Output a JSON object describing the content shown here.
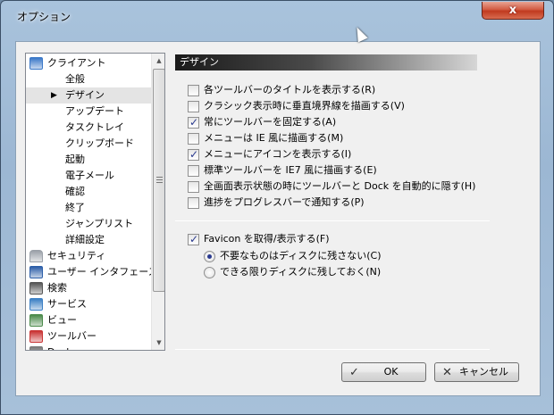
{
  "window": {
    "title": "オプション",
    "close_glyph": "x"
  },
  "tree": {
    "items": [
      {
        "label": "クライアント",
        "icon": "client-icon",
        "level": 0
      },
      {
        "label": "全般",
        "level": 1
      },
      {
        "label": "デザイン",
        "level": 1,
        "selected": true,
        "arrow": "▶"
      },
      {
        "label": "アップデート",
        "level": 1
      },
      {
        "label": "タスクトレイ",
        "level": 1
      },
      {
        "label": "クリップボード",
        "level": 1
      },
      {
        "label": "起動",
        "level": 1
      },
      {
        "label": "電子メール",
        "level": 1
      },
      {
        "label": "確認",
        "level": 1
      },
      {
        "label": "終了",
        "level": 1
      },
      {
        "label": "ジャンプリスト",
        "level": 1
      },
      {
        "label": "詳細設定",
        "level": 1
      },
      {
        "label": "セキュリティ",
        "icon": "lock-icon",
        "level": 0
      },
      {
        "label": "ユーザー インタフェース",
        "icon": "user-interface-icon",
        "level": 0
      },
      {
        "label": "検索",
        "icon": "search-icon",
        "level": 0
      },
      {
        "label": "サービス",
        "icon": "services-icon",
        "level": 0
      },
      {
        "label": "ビュー",
        "icon": "view-icon",
        "level": 0
      },
      {
        "label": "ツールバー",
        "icon": "toolbar-icon",
        "level": 0
      },
      {
        "label": "Dock",
        "icon": "dock-icon",
        "level": 0
      }
    ]
  },
  "design": {
    "header": "デザイン",
    "options": [
      {
        "label": "各ツールバーのタイトルを表示する(R)",
        "checked": false
      },
      {
        "label": "クラシック表示時に垂直境界線を描画する(V)",
        "checked": false
      },
      {
        "label": "常にツールバーを固定する(A)",
        "checked": true
      },
      {
        "label": "メニューは IE 風に描画する(M)",
        "checked": false
      },
      {
        "label": "メニューにアイコンを表示する(I)",
        "checked": true
      },
      {
        "label": "標準ツールバーを IE7 風に描画する(E)",
        "checked": false
      },
      {
        "label": "全画面表示状態の時にツールバーと Dock を自動的に隠す(H)",
        "checked": false
      },
      {
        "label": "進捗をプログレスバーで通知する(P)",
        "checked": false
      }
    ],
    "favicon": {
      "label": "Favicon を取得/表示する(F)",
      "checked": true
    },
    "radios": [
      {
        "label": "不要なものはディスクに残さない(C)",
        "checked": true
      },
      {
        "label": "できる限りディスクに残しておく(N)",
        "checked": false
      }
    ]
  },
  "buttons": {
    "ok": {
      "label": "OK",
      "icon": "check-icon",
      "glyph": "✓"
    },
    "cancel": {
      "label": "キャンセル",
      "icon": "close-icon",
      "glyph": "✕"
    }
  },
  "colors": {
    "selection": "#e4e4e4",
    "header_dark": "#1a1a1a",
    "close_red": "#c13a1f"
  }
}
